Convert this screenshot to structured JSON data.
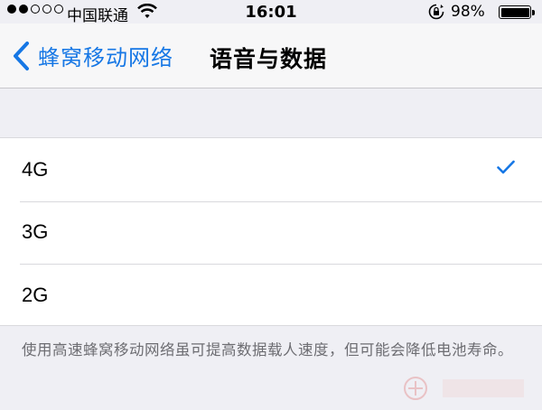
{
  "status_bar": {
    "carrier": "中国联通",
    "time": "16:01",
    "battery_percent": "98%",
    "signal_strength": 2,
    "signal_max": 5,
    "icons": [
      "wifi-icon",
      "rotation-lock-icon",
      "battery-icon"
    ]
  },
  "nav": {
    "back_label": "蜂窝移动网络",
    "title": "语音与数据",
    "accent_color": "#1677e5"
  },
  "options": [
    {
      "label": "4G",
      "selected": true
    },
    {
      "label": "3G",
      "selected": false
    },
    {
      "label": "2G",
      "selected": false
    }
  ],
  "footer": {
    "text": "使用高速蜂窝移动网络虽可提高数据载人速度，但可能会降低电池寿命。"
  }
}
